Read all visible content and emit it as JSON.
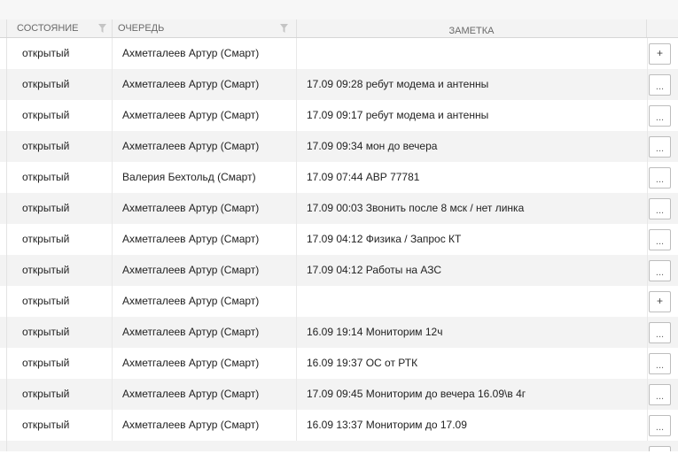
{
  "header": {
    "state": "СОСТОЯНИЕ",
    "queue": "ОЧЕРЕДЬ",
    "note": "ЗАМЕТКА"
  },
  "rows": [
    {
      "state": "открытый",
      "queue": "Ахметгалеев Артур (Смарт)",
      "note": "",
      "action": "+"
    },
    {
      "state": "открытый",
      "queue": "Ахметгалеев Артур (Смарт)",
      "note": "17.09 09:28 ребут модема и антенны",
      "action": "..."
    },
    {
      "state": "открытый",
      "queue": "Ахметгалеев Артур (Смарт)",
      "note": "17.09 09:17 ребут модема и антенны",
      "action": "..."
    },
    {
      "state": "открытый",
      "queue": "Ахметгалеев Артур (Смарт)",
      "note": "17.09 09:34 мон до вечера",
      "action": "..."
    },
    {
      "state": "открытый",
      "queue": "Валерия Бехтольд (Смарт)",
      "note": "17.09 07:44 АВР 77781",
      "action": "..."
    },
    {
      "state": "открытый",
      "queue": "Ахметгалеев Артур (Смарт)",
      "note": "17.09 00:03 Звонить после 8 мск / нет линка",
      "action": "..."
    },
    {
      "state": "открытый",
      "queue": "Ахметгалеев Артур (Смарт)",
      "note": "17.09 04:12 Физика / Запрос КТ",
      "action": "..."
    },
    {
      "state": "открытый",
      "queue": "Ахметгалеев Артур (Смарт)",
      "note": "17.09 04:12 Работы на АЗС",
      "action": "..."
    },
    {
      "state": "открытый",
      "queue": "Ахметгалеев Артур (Смарт)",
      "note": "",
      "action": "+"
    },
    {
      "state": "открытый",
      "queue": "Ахметгалеев Артур (Смарт)",
      "note": "16.09 19:14 Мониторим 12ч",
      "action": "..."
    },
    {
      "state": "открытый",
      "queue": "Ахметгалеев Артур (Смарт)",
      "note": "16.09 19:37 ОС от РТК",
      "action": "..."
    },
    {
      "state": "открытый",
      "queue": "Ахметгалеев Артур (Смарт)",
      "note": "17.09 09:45 Мониторим до вечера 16.09\\в 4г",
      "action": "..."
    },
    {
      "state": "открытый",
      "queue": "Ахметгалеев Артур (Смарт)",
      "note": "16.09 13:37 Мониторим до 17.09",
      "action": "..."
    }
  ],
  "colors": {
    "row_alt": "#f3f3f3",
    "header_bg": "#f3f3f3",
    "header_text": "#6a6a6a",
    "border": "#d6d6d6"
  },
  "icons": {
    "filter": "filter-funnel-icon",
    "add": "plus-icon",
    "more": "ellipsis-icon"
  }
}
